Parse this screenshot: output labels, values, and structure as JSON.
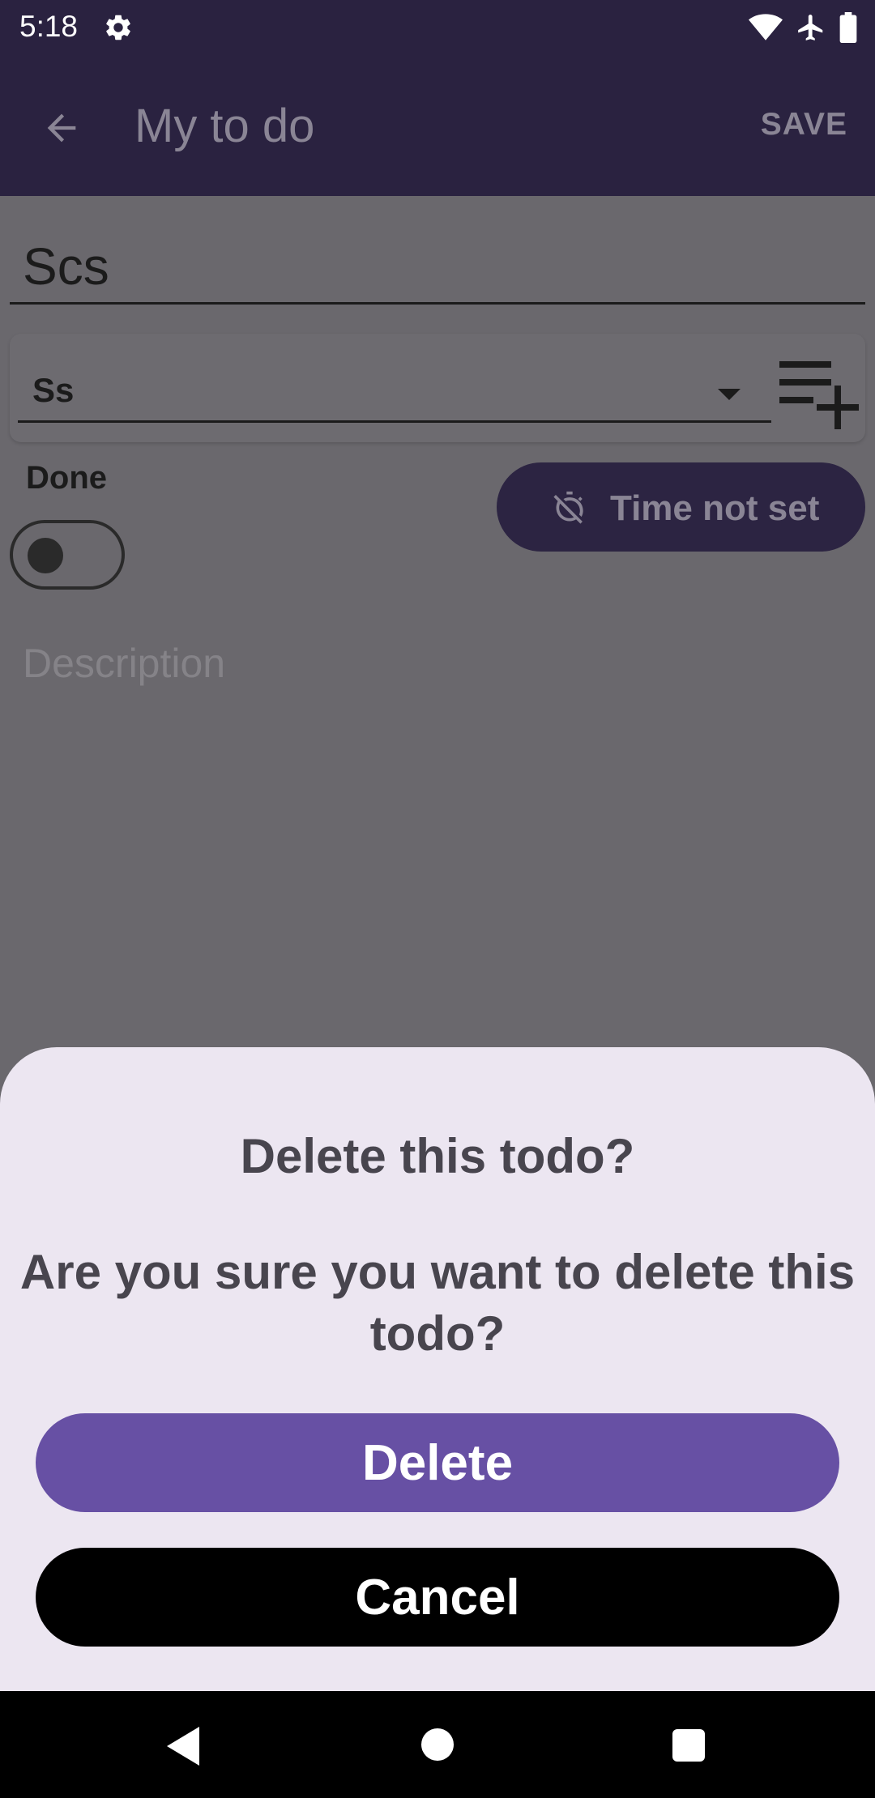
{
  "status_bar": {
    "time": "5:18",
    "icons": [
      "gear-icon",
      "wifi-icon",
      "airplane-icon",
      "battery-icon"
    ]
  },
  "app_bar": {
    "title": "My to do",
    "save_label": "SAVE",
    "back_icon": "arrow-back-icon"
  },
  "form": {
    "title_value": "Scs",
    "category_value": "Ss",
    "done_label": "Done",
    "done_checked": false,
    "time_label": "Time not set",
    "description_placeholder": "Description"
  },
  "dialog": {
    "title": "Delete this todo?",
    "message": "Are you sure you want to delete this todo?",
    "delete_label": "Delete",
    "cancel_label": "Cancel"
  },
  "colors": {
    "primary": "#6750a4",
    "app_bar": "#2a2240",
    "sheet_bg": "#ece6f1",
    "scrim_bg": "#6a686d"
  }
}
